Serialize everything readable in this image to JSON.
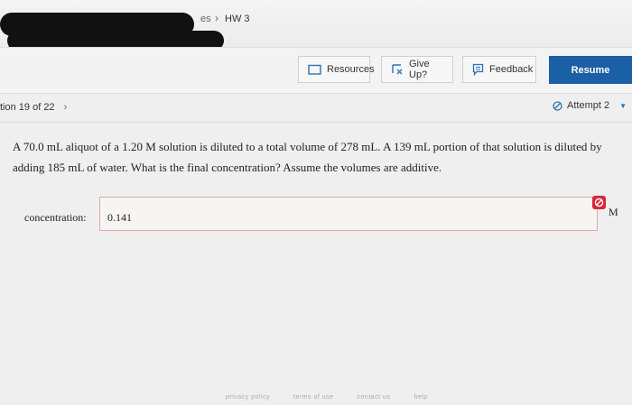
{
  "breadcrumb": {
    "parent": "es",
    "separator": "›",
    "current": "HW 3"
  },
  "toolbar": {
    "resources_label": "Resources",
    "giveup_label": "Give Up?",
    "feedback_label": "Feedback",
    "resume_label": "Resume"
  },
  "nav": {
    "position": "tion 19 of 22",
    "next_arrow": "›"
  },
  "attempt": {
    "label": "Attempt 2"
  },
  "question": {
    "text": "A 70.0 mL aliquot of a 1.20 M solution is diluted to a total volume of 278 mL. A 139 mL portion of that solution is diluted by adding 185 mL of water. What is the final concentration? Assume the volumes are additive."
  },
  "answer": {
    "label": "concentration:",
    "value": "0.141",
    "unit": "M",
    "status": "incorrect"
  },
  "footer": {
    "links": [
      "privacy policy",
      "terms of use",
      "contact us",
      "help"
    ]
  },
  "colors": {
    "accent": "#1b5fa5",
    "error": "#d7263d",
    "link": "#2a73b5"
  }
}
